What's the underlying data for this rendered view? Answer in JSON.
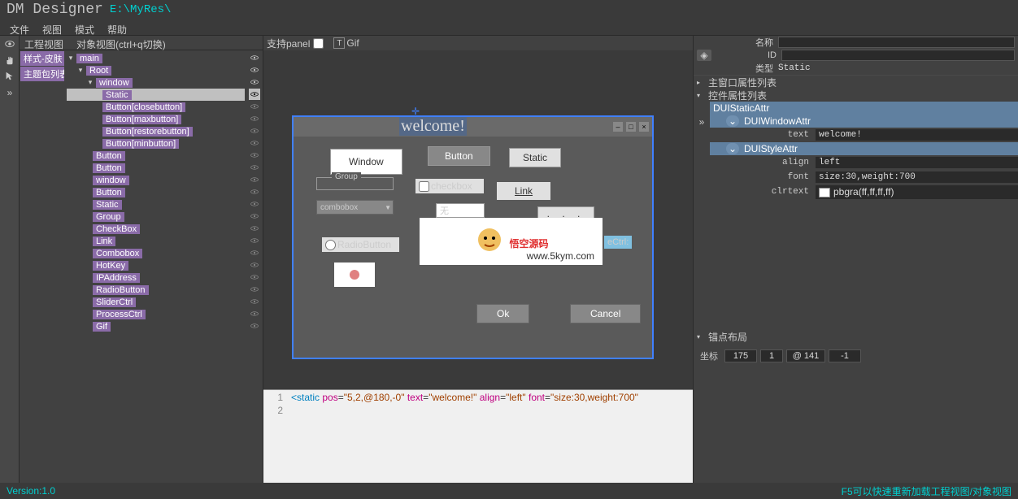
{
  "titlebar": {
    "app": "DM Designer",
    "path": "E:\\MyRes\\"
  },
  "menu": {
    "file": "文件",
    "view": "视图",
    "mode": "模式",
    "help": "帮助"
  },
  "leftTabs": {
    "proj": "工程视图",
    "obj": "对象视图(ctrl+q切换)",
    "panel": "支持panel"
  },
  "centerTool": {
    "gif": "Gif",
    "t": "T"
  },
  "styleList": {
    "a": "样式-皮肤",
    "b": "主题包列表"
  },
  "tree": {
    "main": "main",
    "root": "Root",
    "window": "window",
    "static": "Static",
    "btnClose": "Button[closebutton]",
    "btnMax": "Button[maxbutton]",
    "btnRestore": "Button[restorebutton]",
    "btnMin": "Button[minbutton]",
    "button1": "Button",
    "button2": "Button",
    "window2": "window",
    "button3": "Button",
    "static2": "Static",
    "group": "Group",
    "checkbox": "CheckBox",
    "link": "Link",
    "combobox": "Combobox",
    "hotkey": "HotKey",
    "ipaddress": "IPAddress",
    "radiobutton": "RadioButton",
    "sliderctrl": "SliderCtrl",
    "processctrl": "ProcessCtrl",
    "gif": "Gif"
  },
  "canvas": {
    "title": "welcome!",
    "btnWindow": "Window",
    "btnButton": "Button",
    "btnStatic": "Static",
    "group": "Group",
    "checkbox": "checkbox",
    "link": "Link",
    "combo": "combobox",
    "inputVal": "无",
    "radioLabel": "RadioButton",
    "logoMain": "悟空源码",
    "logoSub": "www.5kym.com",
    "ctrl": "eCtrl:",
    "ok": "Ok",
    "cancel": "Cancel"
  },
  "code": {
    "l1": "1",
    "l2": "2",
    "text": "<static pos=\"5,2,@180,-0\" text=\"welcome!\" align=\"left\" font=\"size:30,weight:700\""
  },
  "props": {
    "nameLabel": "名称",
    "idLabel": "ID",
    "typeLabel": "类型",
    "typeVal": "Static",
    "hostList": "主窗口属性列表",
    "ctrlList": "控件属性列表",
    "duiStatic": "DUIStaticAttr",
    "duiWindow": "DUIWindowAttr",
    "duiStyle": "DUIStyleAttr",
    "textLabel": "text",
    "textVal": "welcome!",
    "alignLabel": "align",
    "alignVal": "left",
    "fontLabel": "font",
    "fontVal": "size:30,weight:700",
    "clrLabel": "clrtext",
    "clrVal": "pbgra(ff,ff,ff,ff)",
    "anchorTitle": "锚点布局",
    "coordLabel": "坐标",
    "c1": "175",
    "c2": "1",
    "c3": "@ 141",
    "c4": "-1"
  },
  "status": {
    "version": "Version:1.0",
    "hint": "F5可以快速重新加载工程视图/对象视图"
  }
}
